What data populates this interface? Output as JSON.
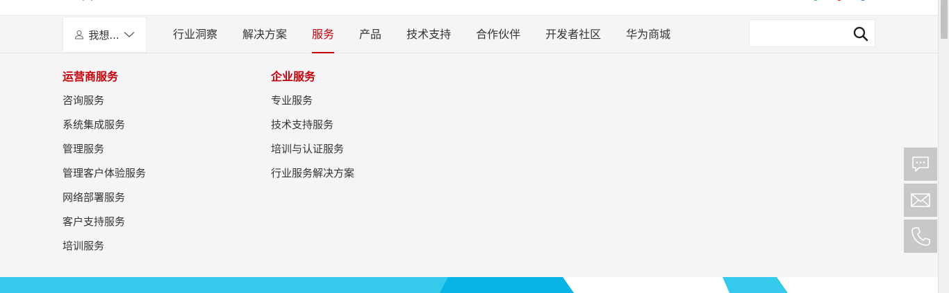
{
  "header": {
    "want_label": "我想...",
    "nav_items": [
      {
        "label": "行业洞察",
        "active": false
      },
      {
        "label": "解决方案",
        "active": false
      },
      {
        "label": "服务",
        "active": true
      },
      {
        "label": "产品",
        "active": false
      },
      {
        "label": "技术支持",
        "active": false
      },
      {
        "label": "合作伙伴",
        "active": false
      },
      {
        "label": "开发者社区",
        "active": false
      },
      {
        "label": "华为商城",
        "active": false
      }
    ],
    "search": {
      "value": "",
      "placeholder": ""
    }
  },
  "dropdown": {
    "columns": [
      {
        "title": "运营商服务",
        "items": [
          "咨询服务",
          "系统集成服务",
          "管理服务",
          "管理客户体验服务",
          "网络部署服务",
          "客户支持服务",
          "培训服务"
        ]
      },
      {
        "title": "企业服务",
        "items": [
          "专业服务",
          "技术支持服务",
          "培训与认证服务",
          "行业服务解决方案"
        ]
      }
    ]
  },
  "float_bar": {
    "icons": [
      "chat-icon",
      "mail-icon",
      "phone-icon"
    ]
  },
  "colors": {
    "accent": "#c7000b",
    "nav_bg": "#f5f5f5",
    "banner_cyan": "#35c9ec",
    "banner_blue": "#0ab4e6",
    "float_bg": "#c8c8c8"
  }
}
